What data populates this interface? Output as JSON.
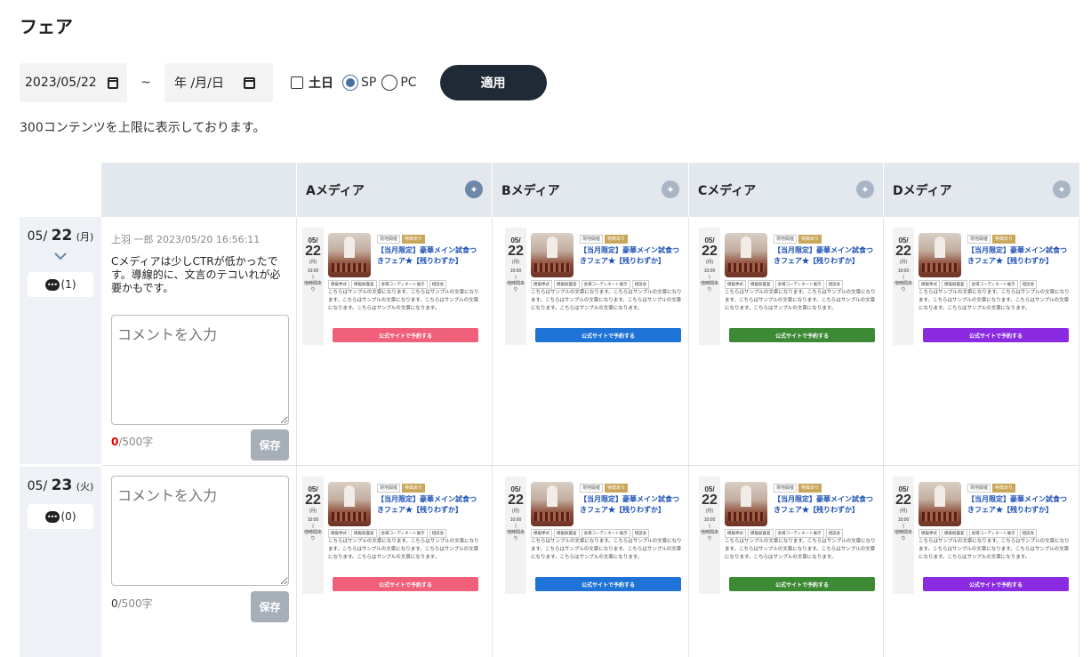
{
  "page_title": "フェア",
  "filters": {
    "start_date": "2023/05/22",
    "tilde": "~",
    "end_date": "年 /月/日",
    "weekend_label": "土日",
    "sp_label": "SP",
    "pc_label": "PC",
    "apply_label": "適用"
  },
  "notice": "300コンテンツを上限に表示しております。",
  "media_headers": [
    {
      "label": "Aメディア",
      "pin": "pin-icon"
    },
    {
      "label": "Bメディア",
      "pin": "pin-icon"
    },
    {
      "label": "Cメディア",
      "pin": "pin-icon"
    },
    {
      "label": "Dメディア",
      "pin": "pin-icon"
    }
  ],
  "colors": {
    "header_bg": "#e3e8ef",
    "apply_bg": "#1f2a36",
    "cta_a": "#f0607a",
    "cta_b": "#1f73d6",
    "cta_c": "#3d8a35",
    "cta_d": "#8a2be2"
  },
  "rows": [
    {
      "date_prefix": "05/",
      "date_day": "22",
      "weekday": "(月)",
      "comment_count": "(1)",
      "comment_meta": "上羽 一郎 2023/05/20 16:56:11",
      "comment_text": "Cメディアは少しCTRが低かったです。導線的に、文言のテコいれが必要かもです。",
      "input_placeholder": "コメントを入力",
      "char_count": "0",
      "char_limit": "/500字",
      "save_label": "保存"
    },
    {
      "date_prefix": "05/",
      "date_day": "23",
      "weekday": "(火)",
      "comment_count": "(0)",
      "input_placeholder": "コメントを入力",
      "char_count": "0",
      "char_limit": "/500字",
      "save_label": "保存"
    }
  ],
  "card": {
    "month": "05/",
    "day": "22",
    "weekday": "(月)",
    "time": "10:00",
    "time_sep": "|",
    "other_times": "他時間あり",
    "tag1": "現地開催",
    "tag2": "特典あり",
    "title": "【当月限定】豪華メイン試食つきフェア★【残りわずか】",
    "chip1": "模擬挙式",
    "chip2": "模擬披露宴",
    "chip3": "会場コーディネート展示",
    "chip4": "相談会",
    "desc": "こちらはサンプルの文章になります。こちらはサンプルの文章になります。こちらはサンプルの文章になります。こちらはサンプルの文章になります。こちらはサンプルの文章になります。",
    "cta": "公式サイトで予約する"
  }
}
